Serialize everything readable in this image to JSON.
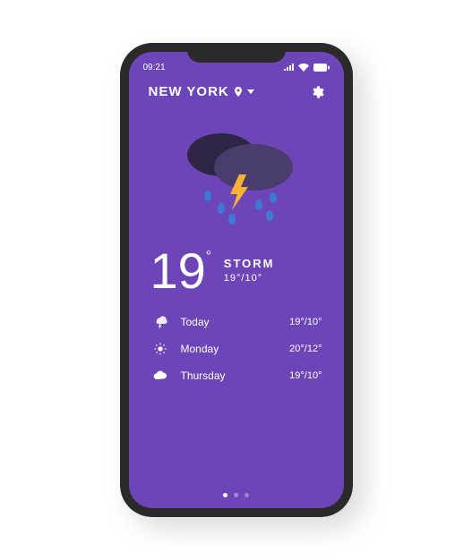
{
  "status": {
    "time": "09:21"
  },
  "location": {
    "city": "NEW YORK"
  },
  "current": {
    "temp": "19",
    "condition": "STORM",
    "hilo": "19°/10°"
  },
  "forecast": [
    {
      "icon": "storm",
      "day": "Today",
      "hilo": "19°/10°"
    },
    {
      "icon": "sun",
      "day": "Monday",
      "hilo": "20°/12°"
    },
    {
      "icon": "cloud",
      "day": "Thursday",
      "hilo": "19°/10°"
    }
  ],
  "pager": {
    "count": 3,
    "active": 0
  }
}
